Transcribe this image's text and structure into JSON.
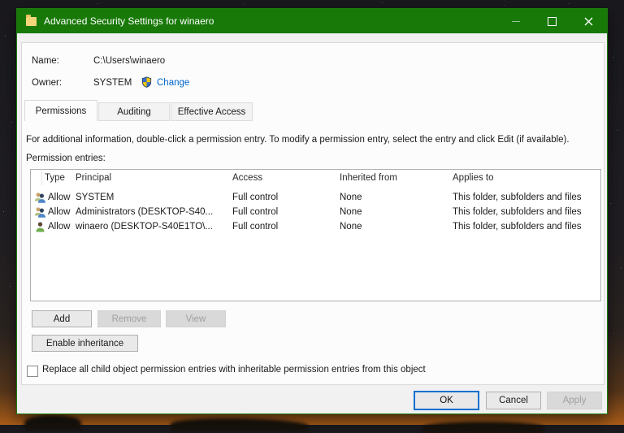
{
  "window": {
    "title": "Advanced Security Settings for winaero"
  },
  "properties": {
    "name_label": "Name:",
    "name_value": "C:\\Users\\winaero",
    "owner_label": "Owner:",
    "owner_value": "SYSTEM",
    "change_link": "Change"
  },
  "tabs": [
    {
      "label": "Permissions",
      "active": true
    },
    {
      "label": "Auditing",
      "active": false
    },
    {
      "label": "Effective Access",
      "active": false
    }
  ],
  "description": "For additional information, double-click a permission entry. To modify a permission entry, select the entry and click Edit (if available).",
  "entries_label": "Permission entries:",
  "table": {
    "columns": [
      "Type",
      "Principal",
      "Access",
      "Inherited from",
      "Applies to"
    ],
    "rows": [
      {
        "icon": "users-icon",
        "type": "Allow",
        "principal": "SYSTEM",
        "access": "Full control",
        "inherited_from": "None",
        "applies_to": "This folder, subfolders and files"
      },
      {
        "icon": "users-icon",
        "type": "Allow",
        "principal": "Administrators (DESKTOP-S40...",
        "access": "Full control",
        "inherited_from": "None",
        "applies_to": "This folder, subfolders and files"
      },
      {
        "icon": "user-icon",
        "type": "Allow",
        "principal": "winaero (DESKTOP-S40E1TO\\...",
        "access": "Full control",
        "inherited_from": "None",
        "applies_to": "This folder, subfolders and files"
      }
    ]
  },
  "buttons": {
    "add": "Add",
    "remove": "Remove",
    "view": "View",
    "enable_inheritance": "Enable inheritance",
    "ok": "OK",
    "cancel": "Cancel",
    "apply": "Apply"
  },
  "checkbox_label": "Replace all child object permission entries with inheritable permission entries from this object",
  "colors": {
    "titlebar_green": "#187908",
    "link_blue": "#0066cc",
    "focus_blue": "#0b6fd0",
    "shield_blue": "#3a70c8",
    "shield_yellow": "#f7c800"
  }
}
